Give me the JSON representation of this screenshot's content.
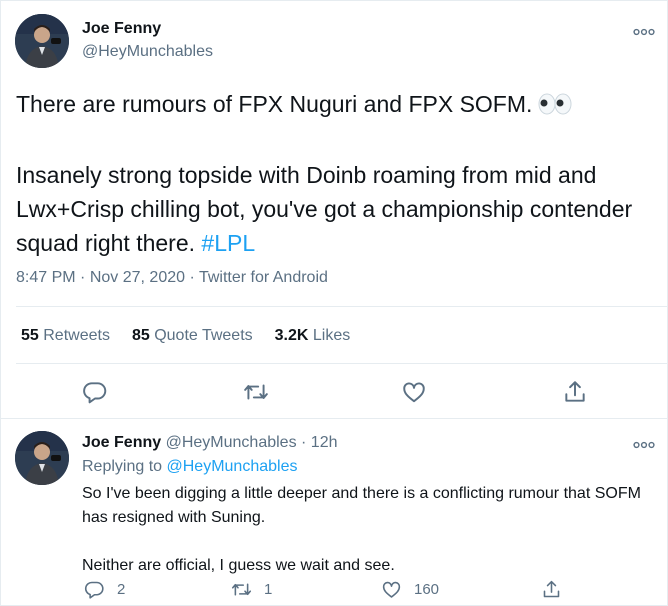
{
  "tweet": {
    "author_name": "Joe Fenny",
    "author_handle": "@HeyMunchables",
    "paragraph1": "There are rumours of FPX Nuguri and FPX SOFM.",
    "paragraph1_emoji": "eyes-emoji",
    "paragraph2": "Insanely strong topside with Doinb roaming from mid and Lwx+Crisp chilling bot, you've got a championship contender squad right there.",
    "hashtag": "#LPL",
    "time": "8:47 PM",
    "date": "Nov 27, 2020",
    "client": "Twitter for Android",
    "separator": "·",
    "stats": {
      "retweets_count": "55",
      "retweets_label": "Retweets",
      "quotes_count": "85",
      "quotes_label": "Quote Tweets",
      "likes_count": "3.2K",
      "likes_label": "Likes"
    },
    "actions": [
      "reply-icon",
      "retweet-icon",
      "like-icon",
      "share-icon"
    ]
  },
  "reply": {
    "author_name": "Joe Fenny",
    "author_handle": "@HeyMunchables",
    "separator": "·",
    "age": "12h",
    "replying_prefix": "Replying to",
    "replying_to": "@HeyMunchables",
    "text1": "So I've been digging a little deeper and there is a conflicting rumour that SOFM has resigned with Suning.",
    "text2": "Neither are official, I guess we wait and see.",
    "reply_count": "2",
    "retweet_count": "1",
    "like_count": "160"
  },
  "colors": {
    "accent": "#1da1f2",
    "text": "#0f1419",
    "secondary": "#5b7083",
    "border": "#e6ecf0"
  }
}
